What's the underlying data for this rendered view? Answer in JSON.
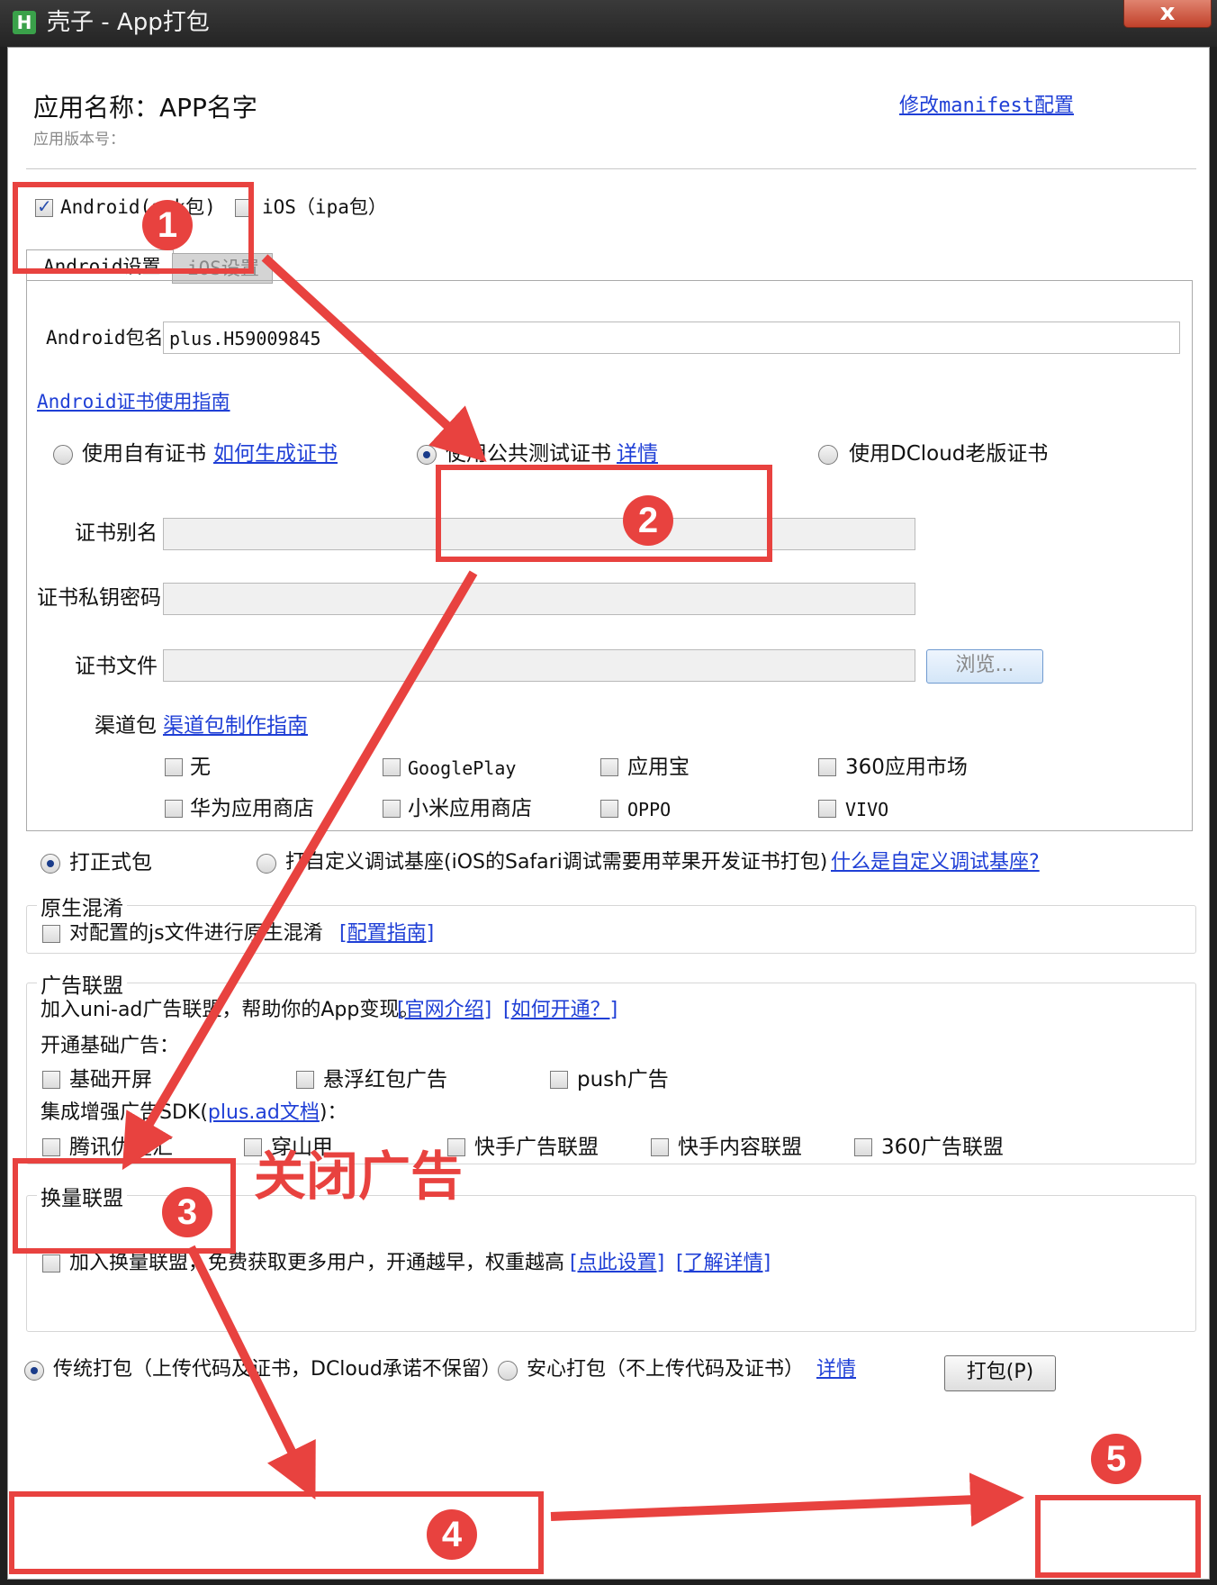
{
  "window": {
    "title": "壳子 - App打包",
    "app_icon": "H",
    "close_label": "x"
  },
  "header": {
    "app_name": "应用名称：APP名字",
    "version": "应用版本号：",
    "manifest_link": "修改manifest配置"
  },
  "platforms": {
    "android_label": "Android(apk包)",
    "ios_label": "iOS（ipa包）"
  },
  "tabs": [
    {
      "label": "Android设置"
    },
    {
      "label": "iOS设置"
    }
  ],
  "android": {
    "package_label": "Android包名",
    "package_value": "plus.H59009845",
    "cert_guide_link": "Android证书使用指南",
    "cert_options": [
      {
        "label": "使用自有证书",
        "link": "如何生成证书"
      },
      {
        "label": "使用公共测试证书",
        "link": "详情"
      },
      {
        "label": "使用DCloud老版证书"
      }
    ],
    "cert_alias_label": "证书别名",
    "cert_password_label": "证书私钥密码",
    "cert_file_label": "证书文件",
    "browse_label": "浏览...",
    "channel_label": "渠道包",
    "channel_guide_link": "渠道包制作指南",
    "channels": [
      "无",
      "GooglePlay",
      "应用宝",
      "360应用市场",
      "华为应用商店",
      "小米应用商店",
      "OPPO",
      "VIVO"
    ]
  },
  "build_type": {
    "formal_label": "打正式包",
    "custom_label": "打自定义调试基座(iOS的Safari调试需要用苹果开发证书打包)",
    "custom_link": "什么是自定义调试基座?"
  },
  "obfuscation": {
    "legend": "原生混淆",
    "checkbox_label": "对配置的js文件进行原生混淆",
    "guide_link": "[配置指南]"
  },
  "ads": {
    "legend": "广告联盟",
    "intro": "加入uni-ad广告联盟，帮助你的App变现。",
    "intro_link1": "[官网介绍]",
    "intro_link2": "[如何开通？]",
    "basic_label": "开通基础广告：",
    "basic_options": [
      "基础开屏",
      "悬浮红包广告",
      "push广告"
    ],
    "sdk_label_prefix": "集成增强广告SDK(",
    "sdk_link": "plus.ad文档",
    "sdk_label_suffix": ")：",
    "sdk_options": [
      "腾讯优量汇",
      "穿山甲",
      "快手广告联盟",
      "快手内容联盟",
      "360广告联盟"
    ],
    "annotation": "关闭广告"
  },
  "exchange": {
    "legend": "换量联盟",
    "checkbox_label": "加入换量联盟，免费获取更多用户，开通越早，权重越高",
    "link1": "[点此设置]",
    "link2": "[了解详情]"
  },
  "footer": {
    "traditional_label": "传统打包（上传代码及证书，DCloud承诺不保留）",
    "safe_label": "安心打包（不上传代码及证书）",
    "safe_link": "详情",
    "pack_button": "打包(P)"
  },
  "annotations": {
    "steps": [
      "1",
      "2",
      "3",
      "4",
      "5"
    ],
    "color": "#e8423f"
  }
}
